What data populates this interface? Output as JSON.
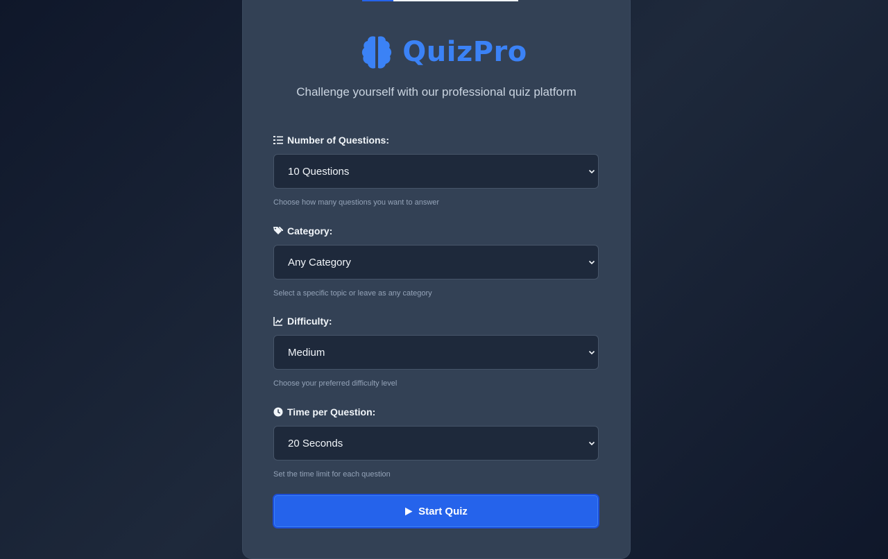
{
  "progress": {
    "value": 0.2
  },
  "brand": {
    "name": "QuizPro",
    "icon": "brain-icon",
    "color": "#3b82f6"
  },
  "subtitle": "Challenge yourself with our professional quiz platform",
  "fields": {
    "questions": {
      "icon": "list-ol-icon",
      "label": "Number of Questions:",
      "value": "10 Questions",
      "hint": "Choose how many questions you want to answer"
    },
    "category": {
      "icon": "tags-icon",
      "label": "Category:",
      "value": "Any Category",
      "hint": "Select a specific topic or leave as any category"
    },
    "difficulty": {
      "icon": "chart-line-icon",
      "label": "Difficulty:",
      "value": "Medium",
      "hint": "Choose your preferred difficulty level"
    },
    "time": {
      "icon": "clock-icon",
      "label": "Time per Question:",
      "value": "20 Seconds",
      "hint": "Set the time limit for each question"
    }
  },
  "start_button": {
    "label": "Start Quiz",
    "icon": "play-icon",
    "color": "#2563eb"
  }
}
